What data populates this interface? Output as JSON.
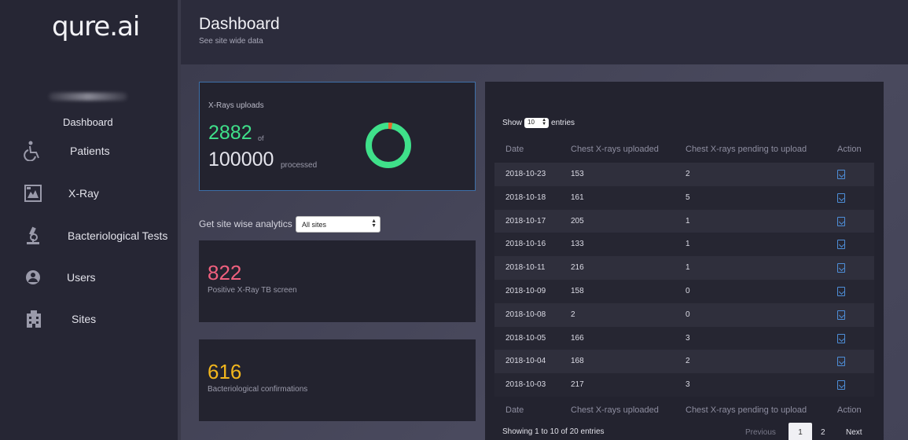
{
  "app": {
    "logo": "qure.ai"
  },
  "sidebar": {
    "dashboard_label": "Dashboard",
    "items": [
      {
        "label": "Patients",
        "icon": "wheelchair-icon"
      },
      {
        "label": "X-Ray",
        "icon": "xray-icon"
      },
      {
        "label": "Bacteriological Tests",
        "icon": "microscope-icon"
      },
      {
        "label": "Users",
        "icon": "users-icon"
      },
      {
        "label": "Sites",
        "icon": "building-icon"
      }
    ]
  },
  "header": {
    "title": "Dashboard",
    "subtitle": "See site wide data"
  },
  "uploads_card": {
    "title": "X-Rays uploads",
    "count": "2882",
    "of": "of",
    "total": "100000",
    "processed": "processed",
    "progress_fraction": 0.02882
  },
  "analytics": {
    "label": "Get site wise analytics",
    "select_value": "All sites"
  },
  "tb_card": {
    "value": "822",
    "label": "Positive X-Ray TB screen",
    "color": "#f0607e"
  },
  "bact_card": {
    "value": "616",
    "label": "Bacteriological confirmations",
    "color": "#f2b61d"
  },
  "table": {
    "show": "Show",
    "entries_value": "10",
    "entries": "entries",
    "headers": [
      "Date",
      "Chest X-rays uploaded",
      "Chest X-rays pending to upload",
      "Action"
    ],
    "rows": [
      {
        "date": "2018-10-23",
        "uploaded": "153",
        "pending": "2"
      },
      {
        "date": "2018-10-18",
        "uploaded": "161",
        "pending": "5"
      },
      {
        "date": "2018-10-17",
        "uploaded": "205",
        "pending": "1"
      },
      {
        "date": "2018-10-16",
        "uploaded": "133",
        "pending": "1"
      },
      {
        "date": "2018-10-11",
        "uploaded": "216",
        "pending": "1"
      },
      {
        "date": "2018-10-09",
        "uploaded": "158",
        "pending": "0"
      },
      {
        "date": "2018-10-08",
        "uploaded": "2",
        "pending": "0"
      },
      {
        "date": "2018-10-05",
        "uploaded": "166",
        "pending": "3"
      },
      {
        "date": "2018-10-04",
        "uploaded": "168",
        "pending": "2"
      },
      {
        "date": "2018-10-03",
        "uploaded": "217",
        "pending": "3"
      }
    ],
    "showing": "Showing 1 to 10 of 20 entries",
    "pagination": {
      "previous": "Previous",
      "page1": "1",
      "page2": "2",
      "next": "Next"
    }
  },
  "colors": {
    "accent_green": "#3fe08a",
    "action_blue": "#4e8fd9"
  }
}
